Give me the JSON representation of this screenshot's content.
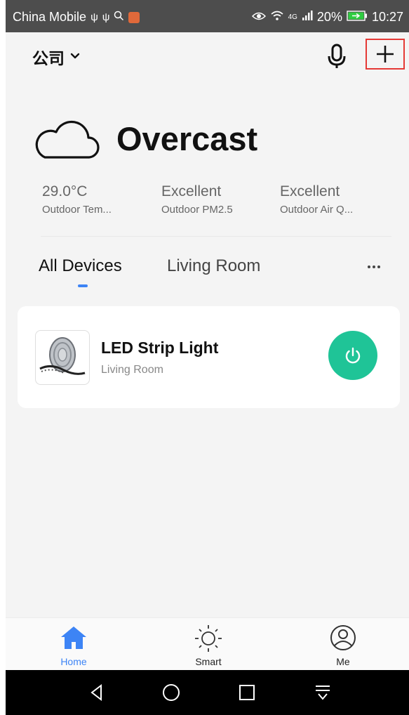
{
  "status_bar": {
    "carrier": "China Mobile",
    "left_icons": [
      "usb-icon",
      "usb-icon",
      "search-icon",
      "app-notification-icon"
    ],
    "right_icons": [
      "eye-icon",
      "wifi-icon",
      "signal-icon"
    ],
    "network": "4G",
    "battery": "20%",
    "time": "10:27"
  },
  "header": {
    "home_name": "公司",
    "icons": [
      "chevron-down-icon",
      "mic-icon",
      "plus-icon"
    ]
  },
  "weather": {
    "condition": "Overcast",
    "icon": "cloud-icon",
    "metrics": [
      {
        "value": "29.0°C",
        "label": "Outdoor Tem..."
      },
      {
        "value": "Excellent",
        "label": "Outdoor PM2.5"
      },
      {
        "value": "Excellent",
        "label": "Outdoor Air Q..."
      }
    ]
  },
  "rooms": {
    "tabs": [
      "All Devices",
      "Living Room"
    ],
    "active": "All Devices",
    "more_icon": "more-icon"
  },
  "devices": [
    {
      "name": "LED Strip Light",
      "room": "Living Room",
      "power_icon": "power-icon"
    }
  ],
  "bottom_nav": [
    {
      "label": "Home",
      "icon": "home-icon",
      "active": true
    },
    {
      "label": "Smart",
      "icon": "sun-icon",
      "active": false
    },
    {
      "label": "Me",
      "icon": "user-icon",
      "active": false
    }
  ],
  "colors": {
    "accent": "#3d84f5",
    "power": "#1fc497",
    "highlight_border": "#e53935",
    "background": "#f4f4f4"
  }
}
